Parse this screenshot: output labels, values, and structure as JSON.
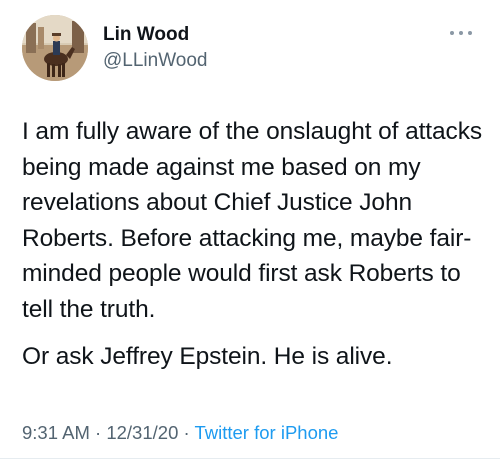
{
  "user": {
    "name": "Lin Wood",
    "handle": "@LLinWood"
  },
  "tweet": {
    "paragraph_1": "I am fully aware of the onslaught of attacks being made against me based on my revelations about Chief Justice John Roberts. Before attacking me, maybe fair-minded people would first ask Roberts to tell the truth.",
    "paragraph_2": "Or ask Jeffrey Epstein. He is alive."
  },
  "meta": {
    "time": "9:31 AM",
    "separator": "·",
    "date": "12/31/20",
    "source": "Twitter for iPhone"
  },
  "icons": {
    "more": "more-dots-icon"
  },
  "colors": {
    "text": "#0f1419",
    "secondary": "#536471",
    "link": "#1d9bf0"
  }
}
